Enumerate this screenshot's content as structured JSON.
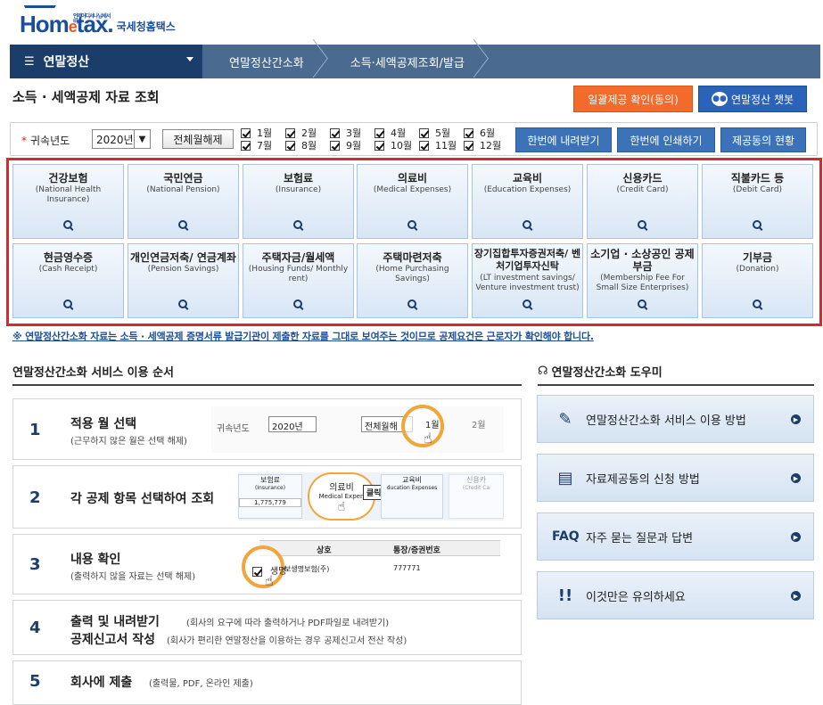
{
  "logo": {
    "brand_prefix": "Hom",
    "brand_e": "e",
    "brand_suffix": "tax.",
    "agency": "국세청홈택스",
    "tiny": "언제어디서나 납세서비스"
  },
  "nav": {
    "menu_icon": "☰",
    "section": "연말정산",
    "breadcrumbs": [
      "연말정산간소화",
      "소득·세액공제조회/발급"
    ]
  },
  "page": {
    "title": "소득 · 세액공제 자료 조회",
    "btn_bulk_consent": "일괄제공 확인(동의)",
    "btn_chatbot": "연말정산 챗봇"
  },
  "filter": {
    "label": "귀속년도",
    "year": "2020년",
    "clear_btn": "전체월해제",
    "months": [
      "1월",
      "2월",
      "3월",
      "4월",
      "5월",
      "6월",
      "7월",
      "8월",
      "9월",
      "10월",
      "11월",
      "12월"
    ],
    "btn_download": "한번에 내려받기",
    "btn_print": "한번에 인쇄하기",
    "btn_consent_status": "제공동의 현황"
  },
  "categories": [
    {
      "ko": "건강보험",
      "en": "(National Health Insurance)"
    },
    {
      "ko": "국민연금",
      "en": "(National Pension)"
    },
    {
      "ko": "보험료",
      "en": "(Insurance)"
    },
    {
      "ko": "의료비",
      "en": "(Medical Expenses)"
    },
    {
      "ko": "교육비",
      "en": "(Education Expenses)"
    },
    {
      "ko": "신용카드",
      "en": "(Credit Card)"
    },
    {
      "ko": "직불카드 등",
      "en": "(Debit Card)"
    },
    {
      "ko": "현금영수증",
      "en": "(Cash Receipt)"
    },
    {
      "ko": "개인연금저축/ 연금계좌",
      "en": "(Pension Savings)"
    },
    {
      "ko": "주택자금/월세액",
      "en": "(Housing Funds/ Monthly rent)"
    },
    {
      "ko": "주택마련저축",
      "en": "(Home Purchasing Savings)"
    },
    {
      "ko": "장기집합투자증권저축/ 벤처기업투자신탁",
      "en": "(LT investment savings/ Venture investment trust)"
    },
    {
      "ko": "소기업 · 소상공인 공제부금",
      "en": "(Membership Fee For Small Size Enterprises)"
    },
    {
      "ko": "기부금",
      "en": "(Donation)"
    }
  ],
  "notice": "※ 연말정산간소화 자료는 소득 · 세액공제 증명서류 발급기관이 제출한 자료를 그대로 보여주는 것이므로 공제요건은 근로자가 확인해야 합니다.",
  "service": {
    "title": "연말정산간소화 서비스 이용 순서",
    "steps": [
      {
        "num": "1",
        "title": "적용 월 선택",
        "sub": "(근무하지 않은 월은 선택 해제)"
      },
      {
        "num": "2",
        "title": "각 공제 항목 선택하여 조회",
        "sub": ""
      },
      {
        "num": "3",
        "title": "내용 확인",
        "sub": "(출력하지 않을 자료는 선택 해제)"
      },
      {
        "num": "4",
        "title": "출력 및 내려받기",
        "sub": "(회사의 요구에 따라 출력하거나 PDF파일로 내려받기)",
        "title2": "공제신고서 작성",
        "sub2": "(회사가 편리한 연말정산을 이용하는 경우 공제신고서 전산 작성)"
      },
      {
        "num": "5",
        "title": "회사에 제출",
        "sub": "(출력물, PDF, 온라인 제출)"
      }
    ],
    "illus1": {
      "label": "귀속년도",
      "year": "2020년",
      "clear": "전체월해",
      "m1": "1월",
      "m2": "2월"
    },
    "illus2": {
      "a_ko": "보험료",
      "a_en": "(Insurance)",
      "a_val": "1,775,779",
      "b_ko": "의료비",
      "b_en": "Medical Expen",
      "click": "클릭!",
      "c_ko": "교육비",
      "c_en": "ducation Expenses",
      "d_ko": "신용카",
      "d_en": "(Credit Ca"
    },
    "illus3": {
      "col1": "상호",
      "col2": "통장/증권번호",
      "row_name": "생명",
      "row_company": "보생명보험(주)",
      "row_num": "777771"
    }
  },
  "help": {
    "title": "연말정산간소화 도우미",
    "items": [
      {
        "icon": "✎",
        "label": "연말정산간소화 서비스 이용 방법"
      },
      {
        "icon": "▤",
        "label": "자료제공동의 신청 방법"
      },
      {
        "icon": "FAQ",
        "label": "자주 묻는 질문과 답변"
      },
      {
        "icon": "!!",
        "label": "이것만은 유의하세요"
      }
    ]
  }
}
